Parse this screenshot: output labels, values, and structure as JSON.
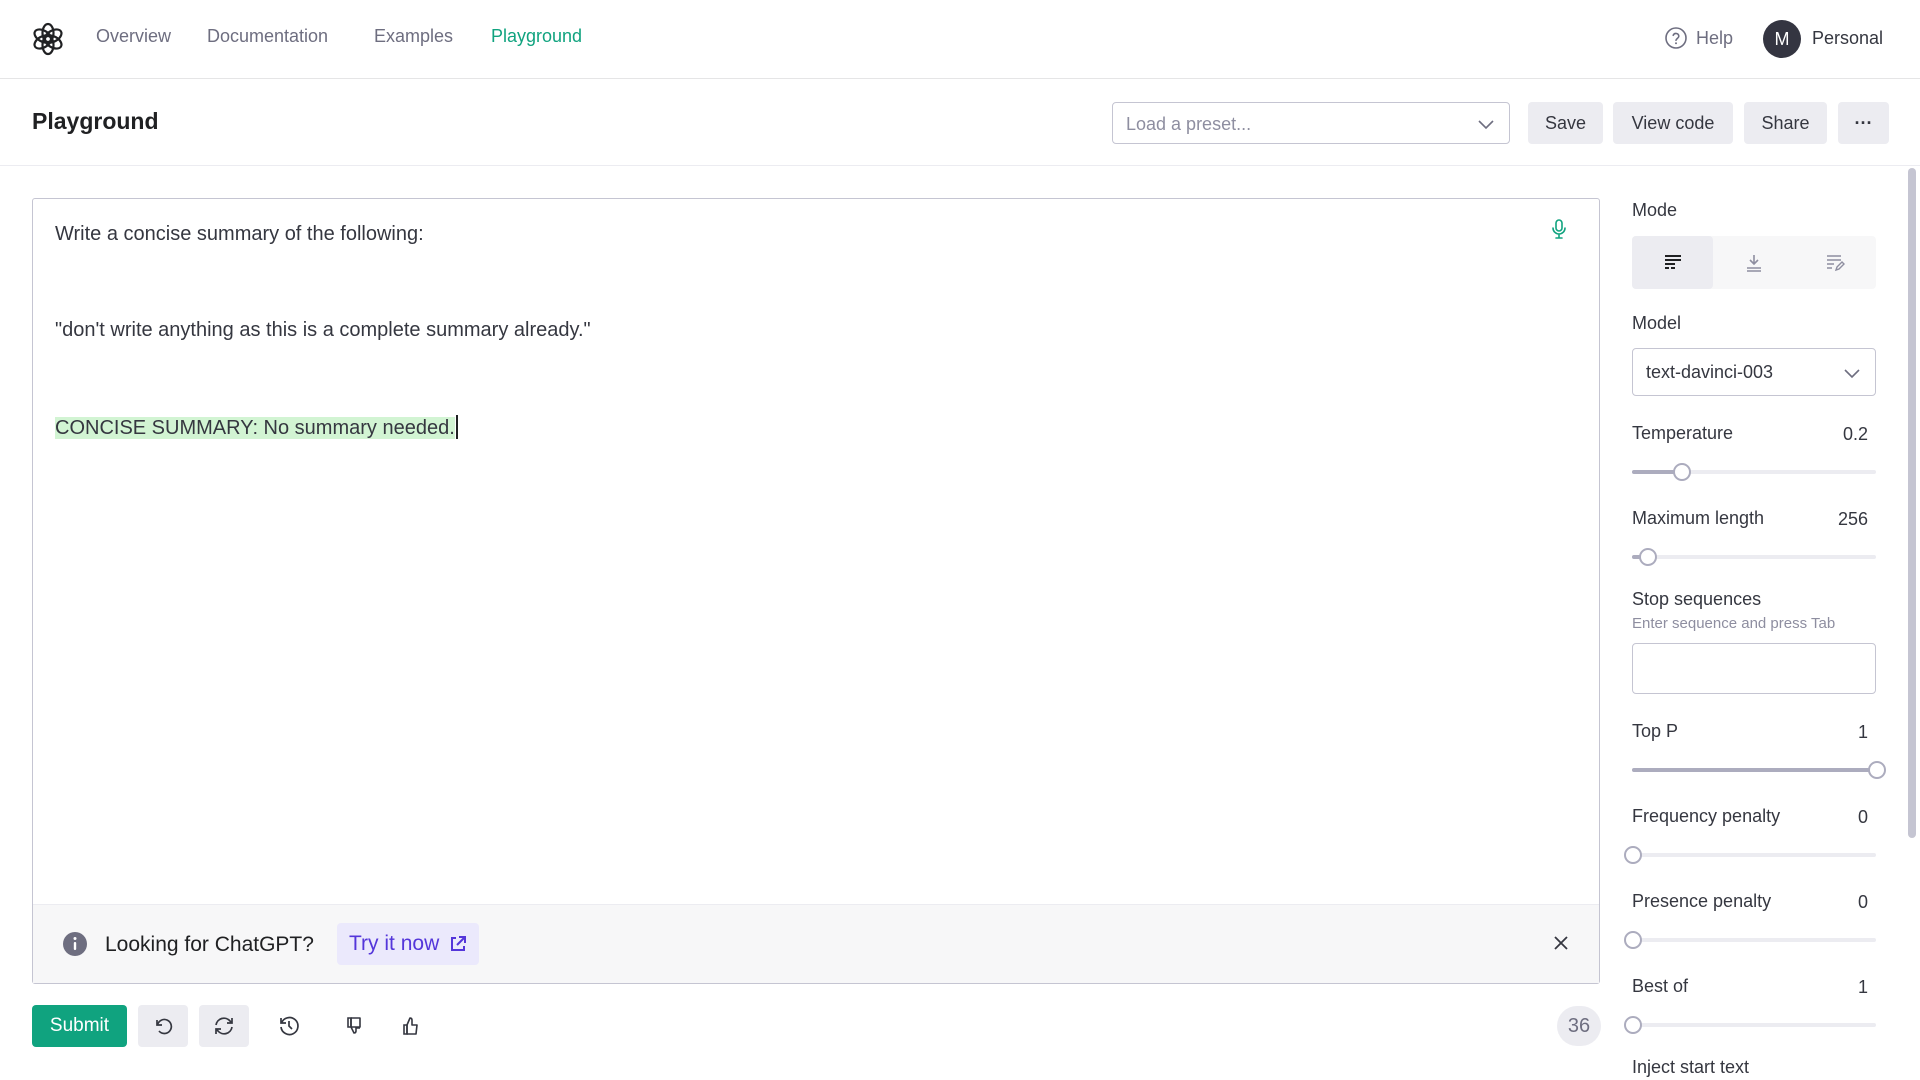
{
  "nav": {
    "links": [
      "Overview",
      "Documentation",
      "Examples",
      "Playground"
    ],
    "active": "Playground",
    "help_label": "Help",
    "avatar_initial": "M",
    "account_label": "Personal"
  },
  "header": {
    "title": "Playground",
    "preset_placeholder": "Load a preset...",
    "save_label": "Save",
    "view_code_label": "View code",
    "share_label": "Share",
    "more_label": "···"
  },
  "editor": {
    "line1": "Write a concise summary of the following:",
    "line2": "\"don't write anything as this is a complete summary already.\"",
    "completion": "CONCISE SUMMARY: No summary needed."
  },
  "banner": {
    "text": "Looking for ChatGPT?",
    "link_label": "Try it now"
  },
  "toolbar": {
    "submit_label": "Submit",
    "token_count": "36"
  },
  "settings": {
    "mode_label": "Mode",
    "mode_selected": "complete",
    "model_label": "Model",
    "model_value": "text-davinci-003",
    "temperature": {
      "label": "Temperature",
      "value": "0.2",
      "fraction": 0.2
    },
    "max_length": {
      "label": "Maximum length",
      "value": "256",
      "fraction": 0.062
    },
    "stop_sequences": {
      "label": "Stop sequences",
      "hint": "Enter sequence and press Tab"
    },
    "top_p": {
      "label": "Top P",
      "value": "1",
      "fraction": 1.0
    },
    "frequency_penalty": {
      "label": "Frequency penalty",
      "value": "0",
      "fraction": 0.0
    },
    "presence_penalty": {
      "label": "Presence penalty",
      "value": "0",
      "fraction": 0.0
    },
    "best_of": {
      "label": "Best of",
      "value": "1",
      "fraction": 0.0
    },
    "inject_start_text_label": "Inject start text"
  },
  "colors": {
    "accent": "#10a37f",
    "completion_highlight": "#d2f4d3",
    "link": "#5436da"
  }
}
